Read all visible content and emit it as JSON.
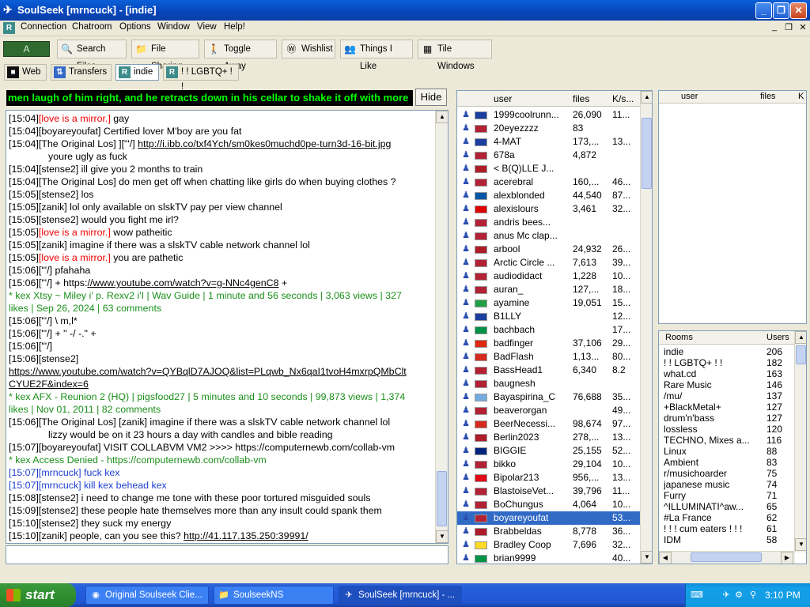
{
  "window": {
    "title": "SoulSeek [mrncuck] - [indie]"
  },
  "menu": [
    "Connection",
    "Chatroom",
    "Options",
    "Window",
    "View",
    "Help!"
  ],
  "logo_text": "A",
  "toolbar": [
    {
      "label": "Search Files",
      "icon": "search-icon"
    },
    {
      "label": "File Sharing",
      "icon": "folder-icon"
    },
    {
      "label": "Toggle Away",
      "icon": "person-icon"
    },
    {
      "label": "Wishlist",
      "icon": "wishlist-icon"
    },
    {
      "label": "Things I Like",
      "icon": "people-icon"
    },
    {
      "label": "Tile Windows",
      "icon": "tile-icon"
    }
  ],
  "tabs": [
    {
      "label": "Web"
    },
    {
      "label": "Transfers"
    },
    {
      "label": "indie",
      "active": true
    },
    {
      "label": "! ! LGBTQ+ ! !"
    }
  ],
  "banner": "men laugh of him right, and he retracts down in his cellar to shake it off with more",
  "hide_label": "Hide",
  "chat": [
    {
      "t": "[15:04]",
      "n": "[love is a mirror.]",
      "m": " gay",
      "c": "red"
    },
    {
      "t": "[15:04]",
      "n": "[boyareyoufat]",
      "m": " Certified lover M'boy are you fat",
      "c": ""
    },
    {
      "t": "[15:04]",
      "n": "[The Original Los]",
      "m": " ][\"'/] ",
      "l": "http://i.ibb.co/txf4Ych/sm0kes0muchd0pe-turn3d-16-bit.jpg",
      "c": ""
    },
    {
      "t": "",
      "n": "",
      "m": "youre ugly as fuck",
      "c": "",
      "indent": true
    },
    {
      "t": "[15:04]",
      "n": "[stense2]",
      "m": " ill give you 2 months to train",
      "c": ""
    },
    {
      "t": "[15:04]",
      "n": "[The Original Los]",
      "m": " do men get off when chatting like girls do when buying clothes ?",
      "c": ""
    },
    {
      "t": "[15:05]",
      "n": "[stense2]",
      "m": " los",
      "c": ""
    },
    {
      "t": "[15:05]",
      "n": "[zanik]",
      "m": " lol only available on slskTV pay per view channel",
      "c": ""
    },
    {
      "t": "[15:05]",
      "n": "[stense2]",
      "m": " would you fight me irl?",
      "c": ""
    },
    {
      "t": "[15:05]",
      "n": "[love is a mirror.]",
      "m": " wow patheitic",
      "c": "red"
    },
    {
      "t": "[15:05]",
      "n": "[zanik]",
      "m": " imagine if there was a slskTV cable network channel lol",
      "c": ""
    },
    {
      "t": "[15:05]",
      "n": "[love is a mirror.]",
      "m": " you are pathetic",
      "c": "red"
    },
    {
      "t": "[15:06]",
      "n": "[\"'/]",
      "m": " pfahaha",
      "c": ""
    },
    {
      "t": "[15:06]",
      "n": "[\"'/]",
      "m": " + https:",
      "l": "//www.youtube.com/watch?v=g-NNc4genC8",
      "m2": " +",
      "c": ""
    },
    {
      "t": "",
      "n": "",
      "m": "* kex Xtsy ~ Miley i' p. Rexv2 i'I | Wav Guide | 1 minute and 56 seconds | 3,063 views | 327",
      "c": "green"
    },
    {
      "t": "",
      "n": "",
      "m": "likes | Sep 26, 2024 | 63 comments",
      "c": "green"
    },
    {
      "t": "[15:06]",
      "n": "[\"'/]",
      "m": " \\ m,l*",
      "c": ""
    },
    {
      "t": "[15:06]",
      "n": "[\"'/]",
      "m": " + \" -/ -.\" +",
      "c": ""
    },
    {
      "t": "[15:06]",
      "n": "[\"'/]",
      "m": "",
      "c": ""
    },
    {
      "t": "[15:06]",
      "n": "[stense2]",
      "m": "",
      "c": ""
    },
    {
      "t": "",
      "n": "",
      "m": "",
      "l": "https://www.youtube.com/watch?v=QYBqlD7AJOQ&list=PLqwb_Nx6qaI1tvoH4mxrpQMbClt",
      "c": ""
    },
    {
      "t": "",
      "n": "",
      "m": "",
      "l": "CYUE2F&index=6",
      "c": ""
    },
    {
      "t": "",
      "n": "",
      "m": "* kex AFX - Reunion 2 (HQ) | pigsfood27 | 5 minutes and 10 seconds | 99,873 views | 1,374",
      "c": "green"
    },
    {
      "t": "",
      "n": "",
      "m": "likes | Nov 01, 2011 | 82 comments",
      "c": "green"
    },
    {
      "t": "[15:06]",
      "n": "[The Original Los]",
      "m": " [zanik] imagine if there was a slskTV cable network channel lol",
      "c": ""
    },
    {
      "t": "",
      "n": "",
      "m": "lizzy would be on it 23 hours a day with candles and bible reading",
      "c": "",
      "indent": true
    },
    {
      "t": "[15:07]",
      "n": "[boyareyoufat]",
      "m": " VISIT COLLABVM VM2 >>>> https://computernewb.com/collab-vm",
      "c": ""
    },
    {
      "t": "",
      "n": "",
      "m": "* kex Access Denied - https://computernewb.com/collab-vm",
      "c": "green"
    },
    {
      "t": "[15:07]",
      "n": "[mrncuck]",
      "m": " fuck kex",
      "c": "blue"
    },
    {
      "t": "[15:07]",
      "n": "[mrncuck]",
      "m": " kill kex behead kex",
      "c": "blue"
    },
    {
      "t": "[15:08]",
      "n": "[stense2]",
      "m": " i need to change me tone with these poor tortured misguided souls",
      "c": ""
    },
    {
      "t": "[15:09]",
      "n": "[stense2]",
      "m": " these people hate themselves more than any insult could spank them",
      "c": ""
    },
    {
      "t": "[15:10]",
      "n": "[stense2]",
      "m": " they suck my energy",
      "c": ""
    },
    {
      "t": "[15:10]",
      "n": "[zanik]",
      "m": " people, can you see this? ",
      "l": "http://41.117.135.250:39991/",
      "c": ""
    }
  ],
  "users_header": {
    "user": "user",
    "files": "files",
    "speed": "K/s..."
  },
  "users": [
    {
      "n": "1999coolrunn...",
      "f": "26,090",
      "s": "11...",
      "flag": "#1a3f9e"
    },
    {
      "n": "20eyezzzz",
      "f": "83",
      "s": "",
      "flag": "#b22234"
    },
    {
      "n": "4-MAT",
      "f": "173,...",
      "s": "13...",
      "flag": "#1a3f9e"
    },
    {
      "n": "678a",
      "f": "4,872",
      "s": "",
      "flag": "#b22234"
    },
    {
      "n": "< B(Q)LLE  J...",
      "f": "",
      "s": "",
      "flag": "#ae1c28"
    },
    {
      "n": "acerebral",
      "f": "160,...",
      "s": "46...",
      "flag": "#b22234"
    },
    {
      "n": "alexblonded",
      "f": "44,540",
      "s": "87...",
      "flag": "#0055a4"
    },
    {
      "n": "alexislours",
      "f": "3,461",
      "s": "32...",
      "flag": "#dd0000"
    },
    {
      "n": "andris bees...",
      "f": "",
      "s": "",
      "flag": "#b22234"
    },
    {
      "n": "anus Mc clap...",
      "f": "",
      "s": "",
      "flag": "#b22234"
    },
    {
      "n": "arbool",
      "f": "24,932",
      "s": "26...",
      "flag": "#ae1c28"
    },
    {
      "n": "Arctic Circle ...",
      "f": "7,613",
      "s": "39...",
      "flag": "#b22234"
    },
    {
      "n": "audiodidact",
      "f": "1,228",
      "s": "10...",
      "flag": "#b22234"
    },
    {
      "n": "auran_",
      "f": "127,...",
      "s": "18...",
      "flag": "#b22234"
    },
    {
      "n": "ayamine",
      "f": "19,051",
      "s": "15...",
      "flag": "#229e45"
    },
    {
      "n": "B1LLY",
      "f": "",
      "s": "12...",
      "flag": "#1a3f9e"
    },
    {
      "n": "bachbach",
      "f": "",
      "s": "17...",
      "flag": "#009246"
    },
    {
      "n": "badfinger",
      "f": "37,106",
      "s": "29...",
      "flag": "#de2910"
    },
    {
      "n": "BadFlash",
      "f": "1,13...",
      "s": "80...",
      "flag": "#d52b1e"
    },
    {
      "n": "BassHead1",
      "f": "6,340",
      "s": "8.2",
      "flag": "#b22234"
    },
    {
      "n": "baugnesh",
      "f": "",
      "s": "",
      "flag": "#b22234"
    },
    {
      "n": "Bayaspirina_C",
      "f": "76,688",
      "s": "35...",
      "flag": "#74acdf"
    },
    {
      "n": "beaverorgan",
      "f": "",
      "s": "49...",
      "flag": "#b22234"
    },
    {
      "n": "BeerNecessi...",
      "f": "98,674",
      "s": "97...",
      "flag": "#d52b1e"
    },
    {
      "n": "Berlin2023",
      "f": "278,...",
      "s": "13...",
      "flag": "#ae1c28"
    },
    {
      "n": "BIGGIE",
      "f": "25,155",
      "s": "52...",
      "flag": "#00247d"
    },
    {
      "n": "bikko",
      "f": "29,104",
      "s": "10...",
      "flag": "#b22234"
    },
    {
      "n": "Bipolar213",
      "f": "956,...",
      "s": "13...",
      "flag": "#e30a17"
    },
    {
      "n": "BlastoiseVet...",
      "f": "39,796",
      "s": "11...",
      "flag": "#b22234"
    },
    {
      "n": "BoChungus",
      "f": "4,064",
      "s": "10...",
      "flag": "#b22234"
    },
    {
      "n": "boyareyoufat",
      "f": "",
      "s": "53...",
      "flag": "#b22234",
      "sel": true
    },
    {
      "n": "Brabbeldas",
      "f": "8,778",
      "s": "36...",
      "flag": "#ae1c28"
    },
    {
      "n": "Bradley Coop",
      "f": "7,696",
      "s": "32...",
      "flag": "#fdda24"
    },
    {
      "n": "brian9999",
      "f": "",
      "s": "40...",
      "flag": "#009246"
    }
  ],
  "right_header": {
    "user": "user",
    "files": "files",
    "k": "K"
  },
  "rooms_header": {
    "name": "Rooms",
    "users": "Users"
  },
  "rooms": [
    {
      "n": "indie",
      "c": "206"
    },
    {
      "n": "! ! LGBTQ+ ! !",
      "c": "182"
    },
    {
      "n": "what.cd",
      "c": "163"
    },
    {
      "n": "Rare Music",
      "c": "146"
    },
    {
      "n": "/mu/",
      "c": "137"
    },
    {
      "n": "+BlackMetal+",
      "c": "127"
    },
    {
      "n": "drum'n'bass",
      "c": "127"
    },
    {
      "n": "lossless",
      "c": "120"
    },
    {
      "n": "TECHNO, Mixes a...",
      "c": "116"
    },
    {
      "n": "Linux",
      "c": "88"
    },
    {
      "n": "Ambient",
      "c": "83"
    },
    {
      "n": "r/musichoarder",
      "c": "75"
    },
    {
      "n": "japanese music",
      "c": "74"
    },
    {
      "n": "Furry",
      "c": "71"
    },
    {
      "n": "^ILLUMINATI^aw...",
      "c": "65"
    },
    {
      "n": "#La France",
      "c": "62"
    },
    {
      "n": "! ! ! cum eaters ! ! !",
      "c": "61"
    },
    {
      "n": "IDM",
      "c": "58"
    }
  ],
  "taskbar": {
    "start": "start",
    "tasks": [
      {
        "label": "Original Soulseek Clie...",
        "active": false
      },
      {
        "label": "SoulseekNS",
        "active": false
      },
      {
        "label": "SoulSeek [mrncuck] - ...",
        "active": true
      }
    ],
    "time": "3:10 PM"
  }
}
